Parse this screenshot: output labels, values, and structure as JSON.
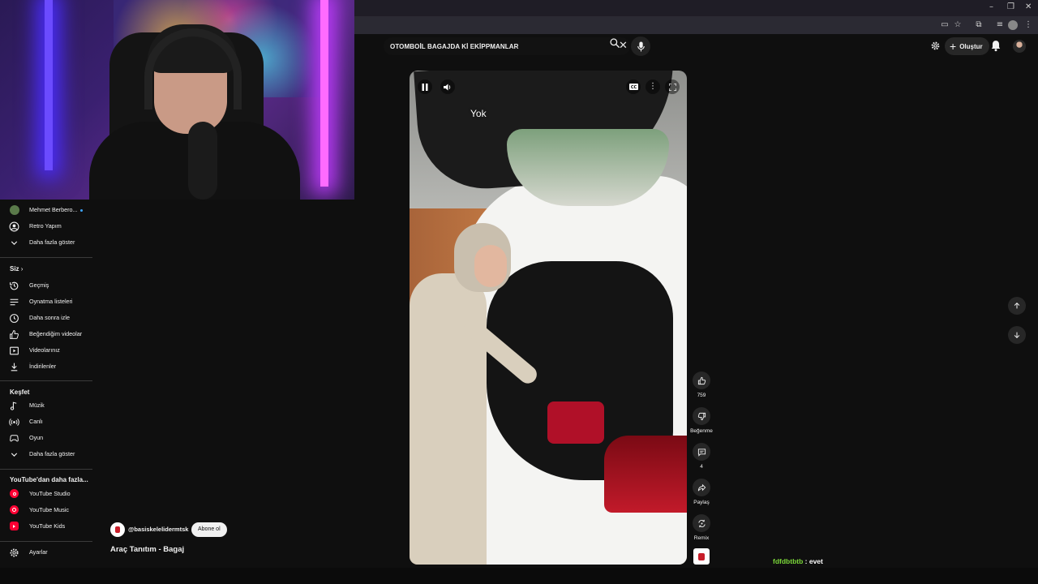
{
  "browser": {
    "window_controls": [
      "–",
      "❐",
      "✕"
    ]
  },
  "search": {
    "query": "OTOMBOİL BAGAJDA Kİ EKİPPMANLAR"
  },
  "header": {
    "create_label": "Oluştur"
  },
  "sidebar": {
    "subscriptions": [
      {
        "label": "Mehmet Berbero...",
        "live": true,
        "avatar_color": "#5a7a4a"
      },
      {
        "label": "Retro Yapım",
        "avatar_color": "#3a3a3a"
      }
    ],
    "show_more_1": "Daha fazla göster",
    "you_heading": "Siz",
    "you_items": [
      {
        "label": "Geçmiş",
        "icon": "history-icon"
      },
      {
        "label": "Oynatma listeleri",
        "icon": "playlist-icon"
      },
      {
        "label": "Daha sonra izle",
        "icon": "clock-icon"
      },
      {
        "label": "Beğendiğim videolar",
        "icon": "thumbs-up-icon"
      },
      {
        "label": "Videolarınız",
        "icon": "video-icon"
      },
      {
        "label": "İndirilenler",
        "icon": "download-icon"
      }
    ],
    "explore_heading": "Keşfet",
    "explore_items": [
      {
        "label": "Müzik",
        "icon": "music-icon"
      },
      {
        "label": "Canlı",
        "icon": "live-icon"
      },
      {
        "label": "Oyun",
        "icon": "game-icon"
      }
    ],
    "show_more_2": "Daha fazla göster",
    "more_heading": "YouTube'dan daha fazla...",
    "more_items": [
      {
        "label": "YouTube Studio",
        "icon": "youtube-studio-icon"
      },
      {
        "label": "YouTube Music",
        "icon": "youtube-music-icon"
      },
      {
        "label": "YouTube Kids",
        "icon": "youtube-kids-icon"
      }
    ],
    "settings_label": "Ayarlar"
  },
  "video": {
    "caption": "Yok",
    "channel_handle": "@basiskelelidermtsk",
    "subscribe_label": "Abone ol",
    "title": "Araç Tanıtım - Bagaj"
  },
  "actions": {
    "likes": "759",
    "dislike_label": "Beğenme",
    "comments": "4",
    "share_label": "Paylaş",
    "remix_label": "Remix"
  },
  "chat": {
    "user": "fdfdbtbtb",
    "message": " : evet",
    "user_color": "#7cd93a"
  },
  "colors": {
    "background": "#0f0f0f",
    "youtube_red": "#ff0033",
    "button_bg": "#272727"
  }
}
